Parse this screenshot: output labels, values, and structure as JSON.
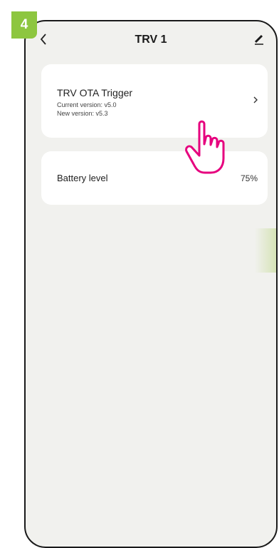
{
  "step_badge": "4",
  "header": {
    "title": "TRV 1"
  },
  "ota_card": {
    "title": "TRV OTA Trigger",
    "current_version": "Current version: v5.0",
    "new_version": "New version: v5.3"
  },
  "battery_card": {
    "label": "Battery level",
    "value": "75%"
  },
  "colors": {
    "badge": "#8dc63f",
    "hand": "#e6007e",
    "background": "#f1f1ee",
    "card": "#ffffff"
  },
  "icons": {
    "back": "chevron-left-icon",
    "edit": "pencil-icon",
    "row_chevron": "chevron-right-icon",
    "pointer": "hand-pointer-icon"
  }
}
